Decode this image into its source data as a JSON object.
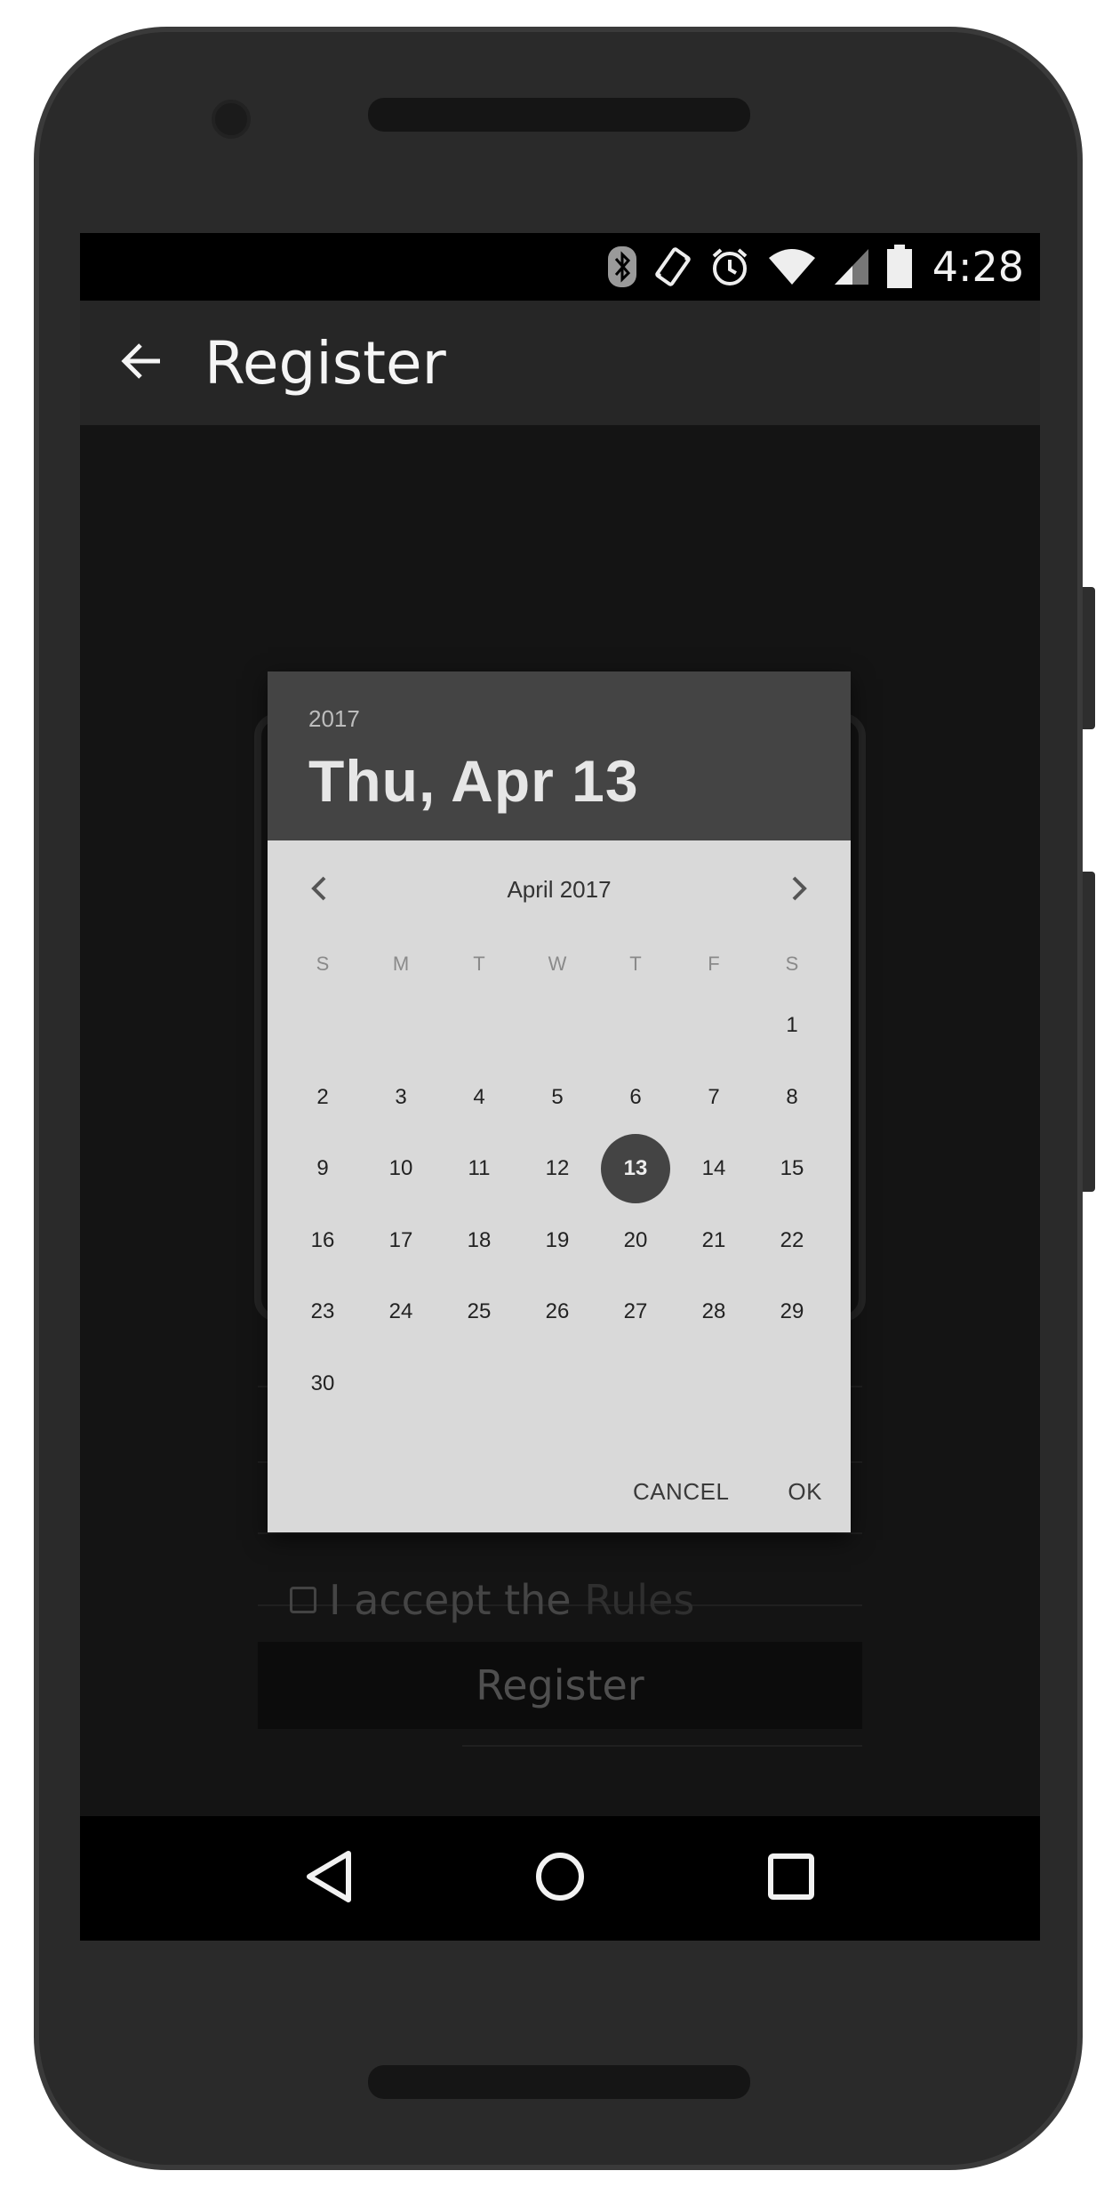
{
  "status_bar": {
    "time": "4:28",
    "icons": [
      "bluetooth-icon",
      "vibrate-icon",
      "alarm-icon",
      "wifi-icon",
      "signal-icon",
      "battery-icon"
    ]
  },
  "app_bar": {
    "title": "Register",
    "back_icon": "arrow-back-icon"
  },
  "date_picker": {
    "header_year": "2017",
    "header_date": "Thu, Apr 13",
    "month_label": "April 2017",
    "weekdays": [
      "S",
      "M",
      "T",
      "W",
      "T",
      "F",
      "S"
    ],
    "weeks": [
      [
        "",
        "",
        "",
        "",
        "",
        "",
        "1"
      ],
      [
        "2",
        "3",
        "4",
        "5",
        "6",
        "7",
        "8"
      ],
      [
        "9",
        "10",
        "11",
        "12",
        "13",
        "14",
        "15"
      ],
      [
        "16",
        "17",
        "18",
        "19",
        "20",
        "21",
        "22"
      ],
      [
        "23",
        "24",
        "25",
        "26",
        "27",
        "28",
        "29"
      ],
      [
        "30",
        "",
        "",
        "",
        "",
        "",
        ""
      ]
    ],
    "selected_day": "13",
    "cancel_label": "CANCEL",
    "ok_label": "OK"
  },
  "form": {
    "accept_prefix": "I accept the ",
    "accept_link": "Rules",
    "register_label": "Register"
  },
  "nav_bar": {
    "back": "nav-back-icon",
    "home": "nav-home-icon",
    "recents": "nav-recents-icon"
  },
  "colors": {
    "header_bg": "#444444",
    "dialog_bg": "#d9d9d9",
    "selected_circle": "#444444",
    "app_bar_bg": "#262626"
  }
}
